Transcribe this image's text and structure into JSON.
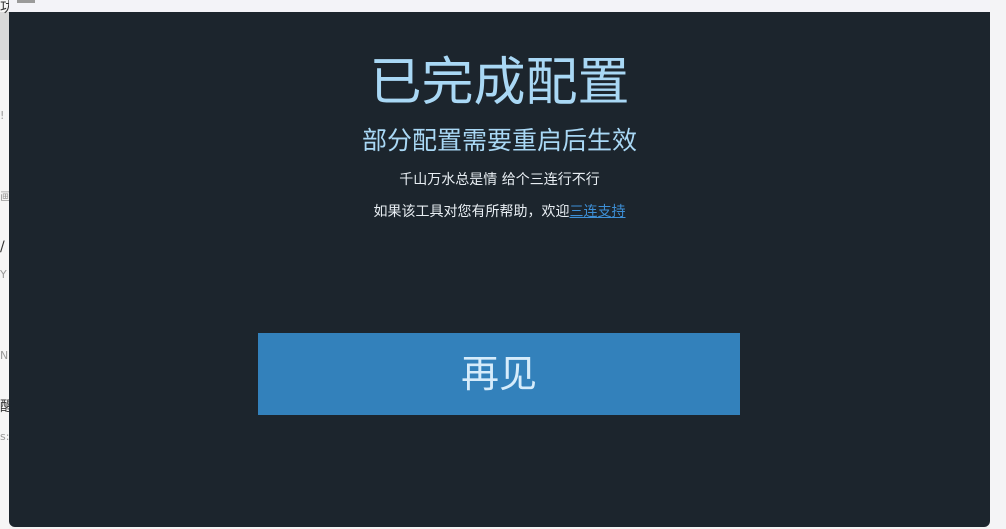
{
  "dialog": {
    "title": "已完成配置",
    "subtitle": "部分配置需要重启后生效",
    "note_line1": "千山万水总是情 给个三连行不行",
    "note_line2_prefix": "如果该工具对您有所帮助，欢迎",
    "support_link_label": "三连支持",
    "bye_button_label": "再见"
  },
  "background": {
    "fragments": [
      "功",
      "!",
      "画",
      "/",
      "Y",
      "N",
      "醒",
      "s:"
    ]
  },
  "colors": {
    "dialog_bg": "#1c252d",
    "title_text": "#a9d8f5",
    "button_bg": "#3381bb",
    "link": "#3d8fd6"
  }
}
